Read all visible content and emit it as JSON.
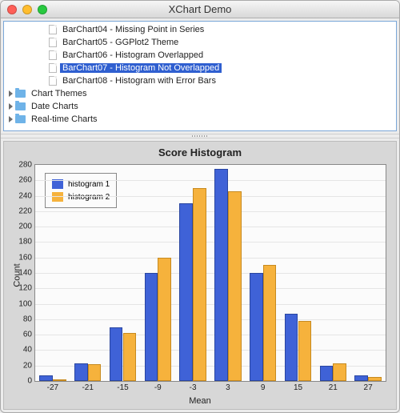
{
  "window": {
    "title": "XChart Demo"
  },
  "tree": {
    "items": [
      {
        "label": "BarChart04 - Missing Point in Series",
        "kind": "file",
        "depth": 2,
        "selected": false
      },
      {
        "label": "BarChart05 - GGPlot2 Theme",
        "kind": "file",
        "depth": 2,
        "selected": false
      },
      {
        "label": "BarChart06 - Histogram Overlapped",
        "kind": "file",
        "depth": 2,
        "selected": false
      },
      {
        "label": "BarChart07 - Histogram Not Overlapped",
        "kind": "file",
        "depth": 2,
        "selected": true
      },
      {
        "label": "BarChart08 - Histogram with Error Bars",
        "kind": "file",
        "depth": 2,
        "selected": false
      },
      {
        "label": "Chart Themes",
        "kind": "folder",
        "depth": 0,
        "selected": false
      },
      {
        "label": "Date Charts",
        "kind": "folder",
        "depth": 0,
        "selected": false
      },
      {
        "label": "Real-time Charts",
        "kind": "folder",
        "depth": 0,
        "selected": false
      }
    ]
  },
  "chart_data": {
    "type": "bar",
    "title": "Score Histogram",
    "xlabel": "Mean",
    "ylabel": "Count",
    "ylim": [
      0,
      280
    ],
    "yticks": [
      0,
      20,
      40,
      60,
      80,
      100,
      120,
      140,
      160,
      180,
      200,
      220,
      240,
      260,
      280
    ],
    "categories": [
      -27,
      -21,
      -15,
      -9,
      -3,
      3,
      9,
      15,
      21,
      27
    ],
    "series": [
      {
        "name": "histogram 1",
        "color": "#3f62d7",
        "values": [
          7,
          23,
          70,
          140,
          230,
          275,
          140,
          87,
          20,
          7
        ]
      },
      {
        "name": "histogram 2",
        "color": "#f6b23c",
        "values": [
          2,
          22,
          62,
          160,
          250,
          246,
          150,
          78,
          23,
          5
        ]
      }
    ]
  }
}
